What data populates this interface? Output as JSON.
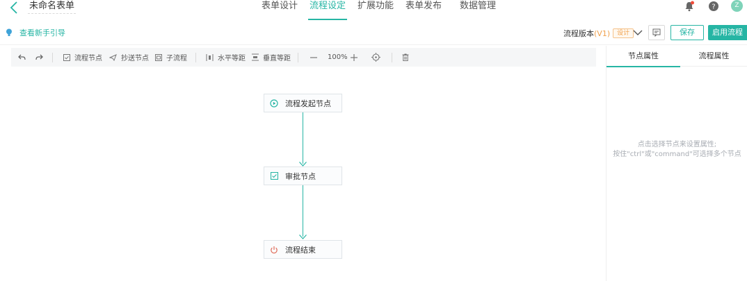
{
  "header": {
    "form_title": "未命名表单",
    "tabs": [
      {
        "label": "表单设计",
        "active": false
      },
      {
        "label": "流程设定",
        "active": true
      },
      {
        "label": "扩展功能",
        "active": false
      },
      {
        "label": "表单发布",
        "active": false
      },
      {
        "label": "数据管理",
        "active": false
      }
    ],
    "avatar_text": "Z",
    "icons": [
      "bell-icon",
      "help-icon"
    ]
  },
  "subbar": {
    "guide_link": "查看新手引导",
    "version_label": "流程版本",
    "version_value": "(V1)",
    "version_badge": "设计",
    "save_label": "保存",
    "enable_label": "启用流程"
  },
  "toolbar": {
    "undo_icon": "undo-icon",
    "redo_icon": "redo-icon",
    "flow_node": "流程节点",
    "cc_node": "抄送节点",
    "sub_flow": "子流程",
    "horizontal_spacing": "水平等距",
    "vertical_spacing": "垂直等距",
    "zoom": "100%"
  },
  "canvas": {
    "nodes": [
      {
        "label": "流程发起节点",
        "icon": "play-circle-icon"
      },
      {
        "label": "审批节点",
        "icon": "approve-check-icon"
      },
      {
        "label": "流程结束",
        "icon": "power-icon"
      }
    ]
  },
  "right_panel": {
    "tabs": [
      {
        "label": "节点属性",
        "active": true
      },
      {
        "label": "流程属性",
        "active": false
      }
    ],
    "hint_line1": "点击选择节点来设置属性;",
    "hint_line2": "按住\"ctrl\"或\"command\"可选择多个节点"
  },
  "colors": {
    "accent": "#26b5a4",
    "version_orange": "#f0a04b",
    "end_icon_red": "#e06c5a"
  }
}
